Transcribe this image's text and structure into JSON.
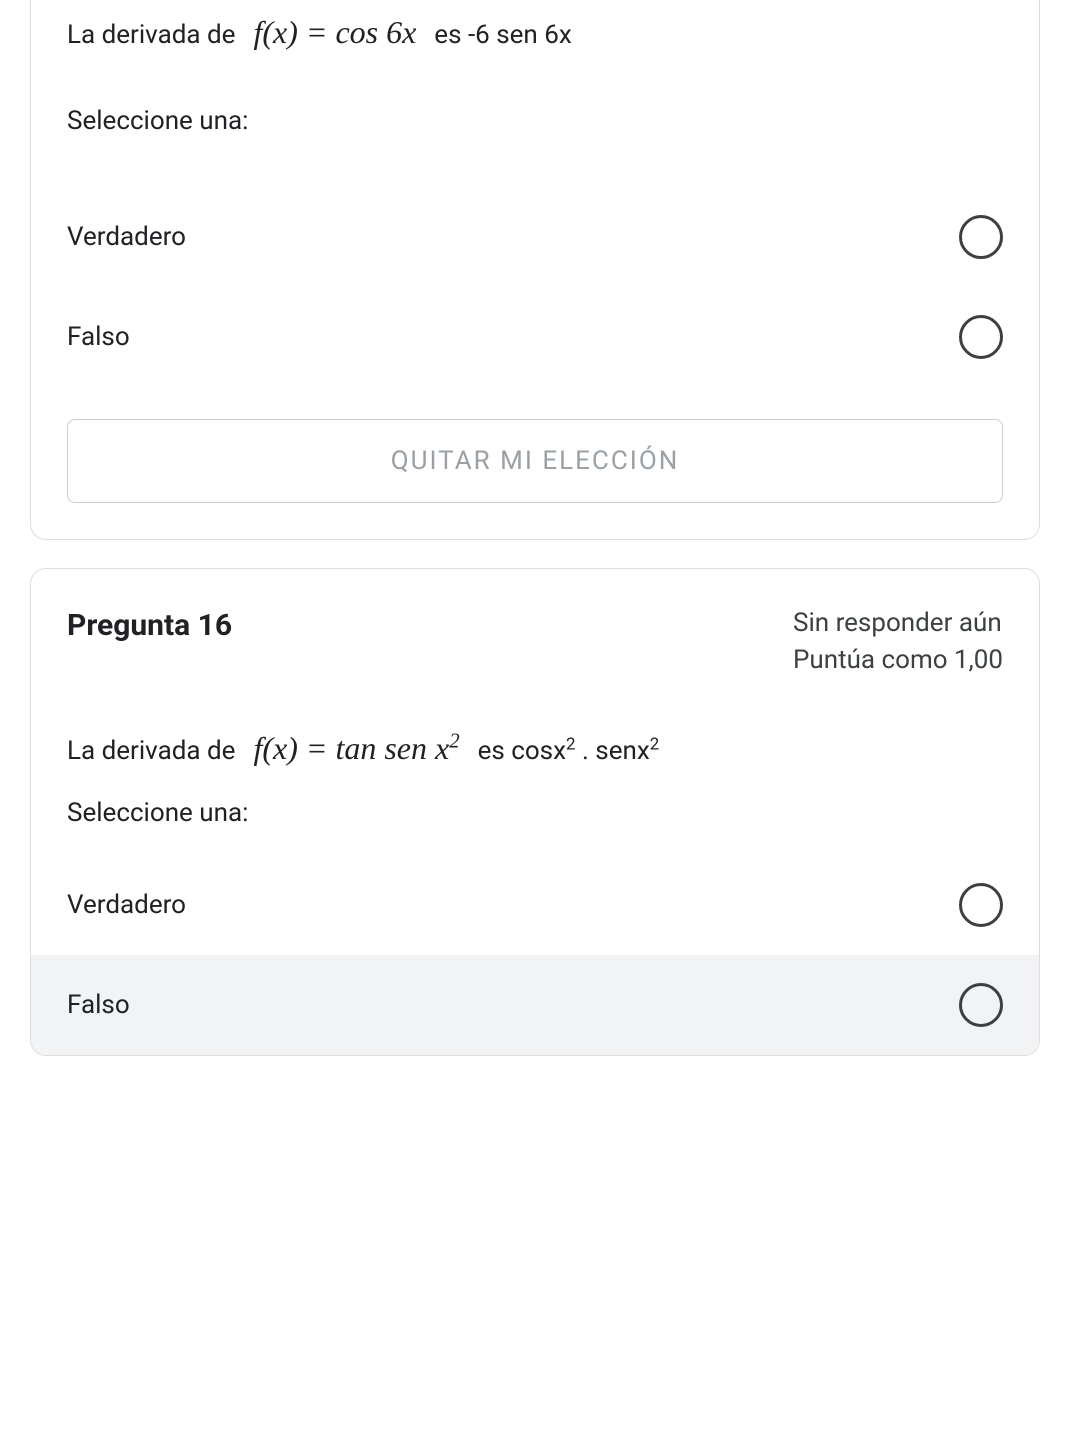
{
  "q15": {
    "text_lead": "La derivada de",
    "formula_html": "<i>f</i>(<i>x</i>) = cos 6<i>x</i>",
    "text_trail": "es  -6 sen 6x",
    "prompt": "Seleccione una:",
    "option_true": "Verdadero",
    "option_false": "Falso",
    "clear_label": "QUITAR MI ELECCIÓN"
  },
  "q16": {
    "title": "Pregunta 16",
    "status": "Sin responder aún",
    "score": "Puntúa como 1,00",
    "text_lead": "La derivada de",
    "formula_html": "<i>f</i>(<i>x</i>) = tan sen <i>x</i><sup>2</sup>",
    "text_trail_html": "es cosx<sup class=\"sq\">2</sup> . senx<sup class=\"sq\">2</sup>",
    "prompt": "Seleccione una:",
    "option_true": "Verdadero",
    "option_false": "Falso"
  }
}
